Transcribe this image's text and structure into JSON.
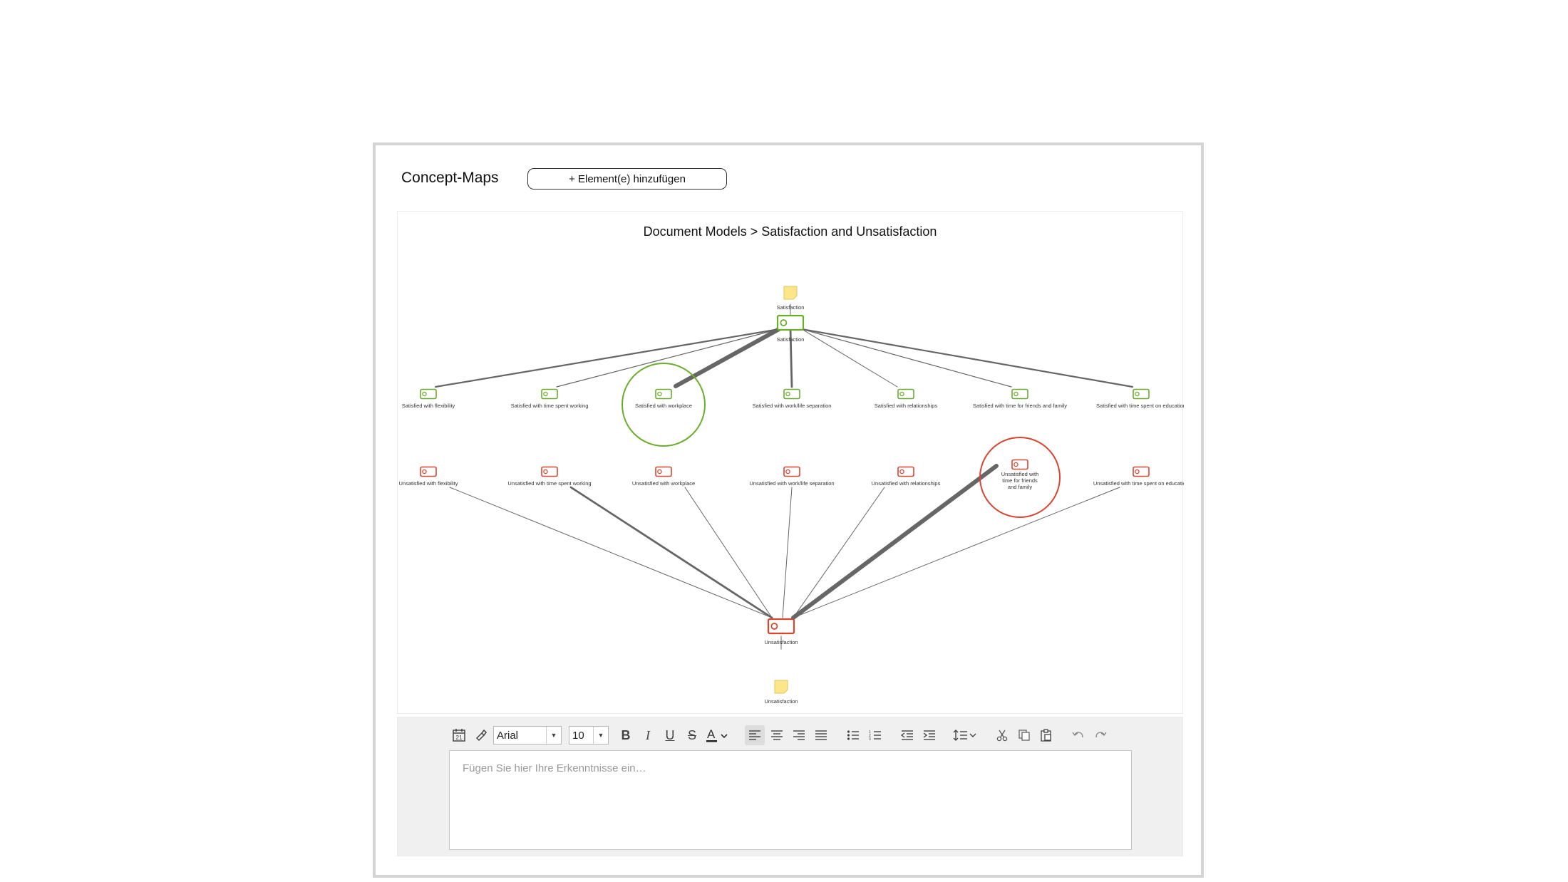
{
  "panel": {
    "title": "Concept-Maps",
    "add_button_label": "+ Element(e) hinzufügen"
  },
  "map": {
    "breadcrumb": "Document Models > Satisfaction and Unsatisfaction",
    "colors": {
      "green": "#6aae2c",
      "red": "#d9452e",
      "memo_fill": "#fbe78a",
      "memo_border": "#e2c65a",
      "edge": "#666666"
    },
    "top_memo_label": "Satisfaction",
    "top_code_label": "Satisfaction",
    "bottom_code_label": "Unsatisfaction",
    "bottom_memo_label": "Unsatisfaction",
    "satisfied_codes": [
      "Satisfied with flexibility",
      "Satisfied with time spent working",
      "Satisfied with workplace",
      "Satisfied with work/life separation",
      "Satisfied with relationships",
      "Satisfied with time for friends and family",
      "Satisfied with time spent on education"
    ],
    "unsatisfied_codes": [
      "Unsatisfied with flexibility",
      "Unsatisfied with time spent working",
      "Unsatisfied with workplace",
      "Unsatisfied with work/life separation",
      "Unsatisfied with relationships",
      "Unsatisfied with time for friends and family",
      "Unsatisfied with time spent on education"
    ],
    "highlighted_unsatisfied_label_lines": [
      "Unsatisfied with",
      "time for friends",
      "and family"
    ]
  },
  "editor": {
    "font_name": "Arial",
    "font_size": "10",
    "placeholder": "Fügen Sie hier Ihre Erkenntnisse ein…",
    "icons": [
      "insert-date-icon",
      "format-painter-icon",
      "bold-icon",
      "italic-icon",
      "underline-icon",
      "strikethrough-icon",
      "font-color-icon",
      "align-left-icon",
      "align-center-icon",
      "align-right-icon",
      "justify-icon",
      "bullet-list-icon",
      "numbered-list-icon",
      "outdent-icon",
      "indent-icon",
      "line-spacing-icon",
      "cut-icon",
      "copy-icon",
      "paste-icon",
      "undo-icon",
      "redo-icon"
    ]
  }
}
